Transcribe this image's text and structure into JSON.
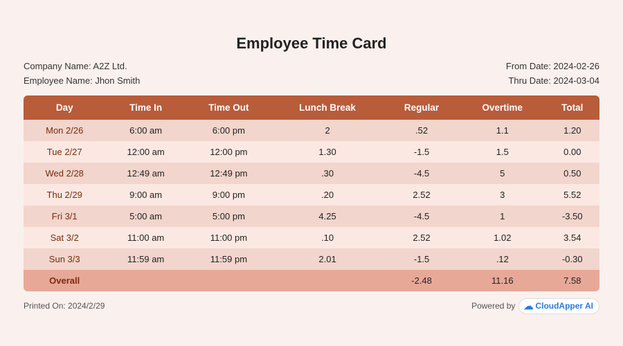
{
  "title": "Employee Time Card",
  "meta": {
    "company_label": "Company Name: A2Z Ltd.",
    "employee_label": "Employee Name: Jhon Smith",
    "from_date_label": "From Date: 2024-02-26",
    "thru_date_label": "Thru Date: 2024-03-04"
  },
  "table": {
    "headers": [
      "Day",
      "Time In",
      "Time Out",
      "Lunch Break",
      "Regular",
      "Overtime",
      "Total"
    ],
    "rows": [
      {
        "day": "Mon 2/26",
        "time_in": "6:00 am",
        "time_out": "6:00 pm",
        "lunch": "2",
        "regular": ".52",
        "overtime": "1.1",
        "total": "1.20"
      },
      {
        "day": "Tue 2/27",
        "time_in": "12:00 am",
        "time_out": "12:00 pm",
        "lunch": "1.30",
        "regular": "-1.5",
        "overtime": "1.5",
        "total": "0.00"
      },
      {
        "day": "Wed 2/28",
        "time_in": "12:49 am",
        "time_out": "12:49 pm",
        "lunch": ".30",
        "regular": "-4.5",
        "overtime": "5",
        "total": "0.50"
      },
      {
        "day": "Thu 2/29",
        "time_in": "9:00 am",
        "time_out": "9:00 pm",
        "lunch": ".20",
        "regular": "2.52",
        "overtime": "3",
        "total": "5.52"
      },
      {
        "day": "Fri 3/1",
        "time_in": "5:00 am",
        "time_out": "5:00 pm",
        "lunch": "4.25",
        "regular": "-4.5",
        "overtime": "1",
        "total": "-3.50"
      },
      {
        "day": "Sat 3/2",
        "time_in": "11:00 am",
        "time_out": "11:00 pm",
        "lunch": ".10",
        "regular": "2.52",
        "overtime": "1.02",
        "total": "3.54"
      },
      {
        "day": "Sun 3/3",
        "time_in": "11:59 am",
        "time_out": "11:59 pm",
        "lunch": "2.01",
        "regular": "-1.5",
        "overtime": ".12",
        "total": "-0.30"
      }
    ],
    "overall": {
      "day": "Overall",
      "regular": "-2.48",
      "overtime": "11.16",
      "total": "7.58"
    }
  },
  "footer": {
    "printed": "Printed On: 2024/2/29",
    "powered_by_label": "Powered by",
    "brand": "CloudApper AI"
  }
}
